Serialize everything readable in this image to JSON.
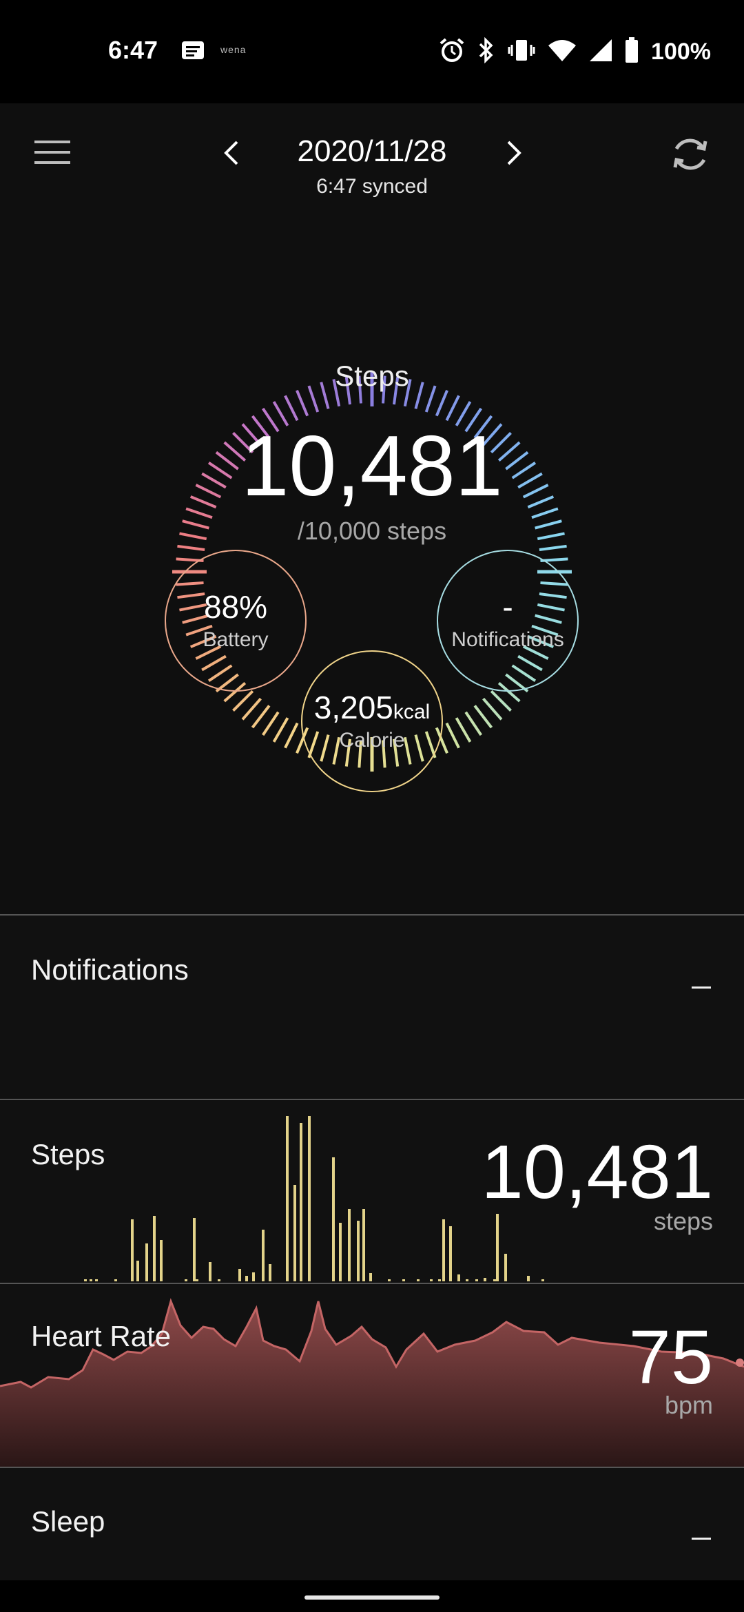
{
  "status_bar": {
    "time": "6:47",
    "app_label": "wena",
    "battery_text": "100%",
    "icons": [
      "message-icon",
      "alarm-icon",
      "bluetooth-icon",
      "vibrate-icon",
      "wifi-icon",
      "cellular-signal-icon",
      "battery-icon"
    ]
  },
  "header": {
    "date": "2020/11/28",
    "sync_status": "6:47 synced",
    "icons": [
      "menu-icon",
      "chevron-left-icon",
      "chevron-right-icon",
      "sync-icon"
    ]
  },
  "dial": {
    "label": "Steps",
    "steps": "10,481",
    "goal_text": "/10,000 steps",
    "progress_fraction": 1.0481,
    "gradient_colors": [
      "#8b7fe0",
      "#7fa8ef",
      "#89d7f0",
      "#a2e0d6",
      "#d9e39a",
      "#f3d98a",
      "#f1b07e",
      "#ee7d82",
      "#c776c8"
    ]
  },
  "metrics": {
    "battery": {
      "value": "88%",
      "label": "Battery",
      "color": "#e9a78a"
    },
    "notifications": {
      "value": "-",
      "label": "Notifications",
      "color": "#a6dce2"
    },
    "calorie": {
      "value": "3,205",
      "unit": "kcal",
      "label": "Calorie",
      "color": "#f0d48a"
    }
  },
  "cards": {
    "notifications": {
      "title": "Notifications",
      "value": "_"
    },
    "steps": {
      "title": "Steps",
      "value": "10,481",
      "unit": "steps",
      "bar_color": "#e3d38a"
    },
    "heart_rate": {
      "title": "Heart Rate",
      "value": "75",
      "unit": "bpm",
      "fill_color": "#8f4a4a",
      "line_color": "#c46565"
    },
    "sleep": {
      "title": "Sleep",
      "value": "_"
    }
  }
}
